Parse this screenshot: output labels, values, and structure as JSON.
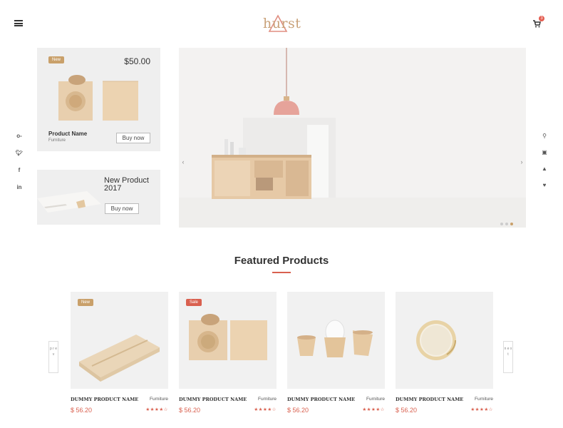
{
  "header": {
    "logo_text": "hurst",
    "cart_count": "3",
    "brand_color": "#c9a27a",
    "accent_color": "#d9604f"
  },
  "social": [
    "key-icon",
    "twitter-icon",
    "facebook-icon",
    "linkedin-icon"
  ],
  "right_tools": [
    "search-icon",
    "lock-icon",
    "user-icon",
    "heart-icon"
  ],
  "promo_card_1": {
    "badge": "New",
    "price": "$50.00",
    "name": "Product Name",
    "category": "Furniture",
    "button": "Buy now"
  },
  "promo_card_2": {
    "title": "New Product 2017",
    "button": "Buy now"
  },
  "hero": {
    "prev_arrow": "‹",
    "next_arrow": "›",
    "slides": 3,
    "active_slide": 3
  },
  "featured": {
    "title": "Featured Products",
    "prev_label": "p r e v",
    "next_label": "n e x t",
    "products": [
      {
        "badge": "New",
        "badge_color": "#c9a06a",
        "name": "DUMMY PRODUCT NAME",
        "category": "Furniture",
        "price": "$ 56.20",
        "stars": "★★★★☆"
      },
      {
        "badge": "Sale",
        "badge_color": "#d9604f",
        "name": "DUMMY PRODUCT NAME",
        "category": "Furniture",
        "price": "$ 56.20",
        "stars": "★★★★☆"
      },
      {
        "badge": "",
        "badge_color": "",
        "name": "DUMMY PRODUCT NAME",
        "category": "Furniture",
        "price": "$ 56.20",
        "stars": "★★★★☆"
      },
      {
        "badge": "",
        "badge_color": "",
        "name": "DUMMY PRODUCT NAME",
        "category": "Furniture",
        "price": "$ 56.20",
        "stars": "★★★★☆"
      }
    ]
  }
}
